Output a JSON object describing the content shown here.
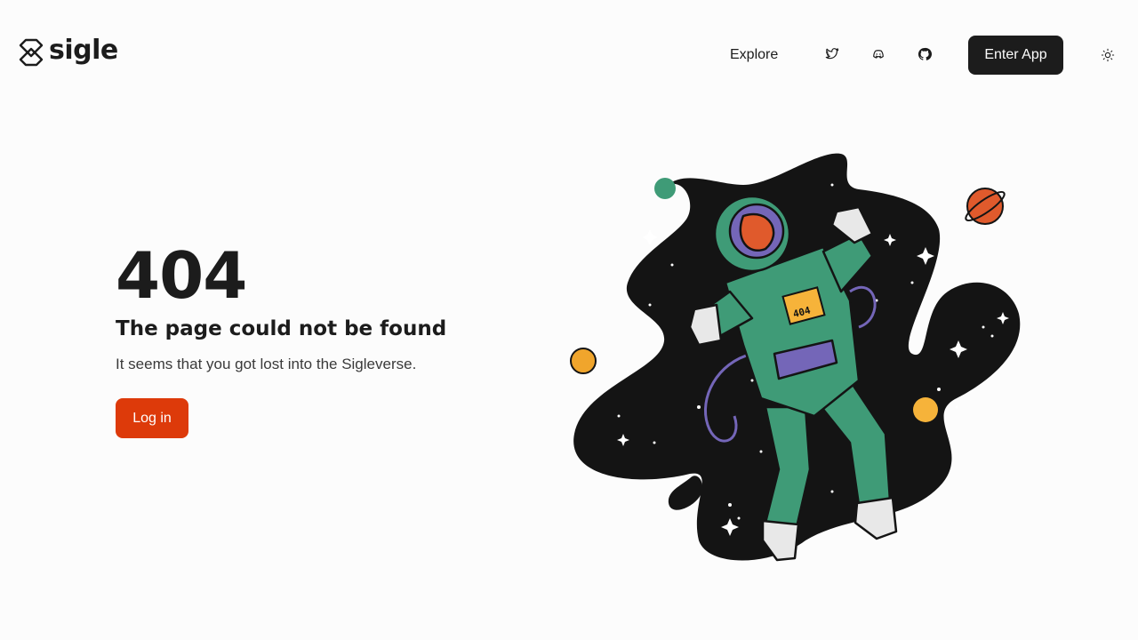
{
  "brand": {
    "name": "sigle",
    "logo_icon": "sigle-logo-icon"
  },
  "nav": {
    "explore_label": "Explore",
    "social": [
      {
        "icon": "twitter-icon"
      },
      {
        "icon": "discord-icon"
      },
      {
        "icon": "github-icon"
      }
    ],
    "enter_app_label": "Enter App",
    "theme_icon": "sun-icon"
  },
  "error": {
    "code": "404",
    "title": "The page could not be found",
    "description": "It seems that you got lost into the Sigleverse.",
    "login_label": "Log in"
  },
  "illustration": {
    "subject": "astronaut-floating-in-space",
    "badge_text": "404"
  },
  "colors": {
    "background": "#fcfcfc",
    "text": "#1c1c1c",
    "primary_button": "#1c1c1c",
    "accent_orange": "#dd3a0a",
    "suit_green": "#3f9b77",
    "space": "#141414"
  }
}
